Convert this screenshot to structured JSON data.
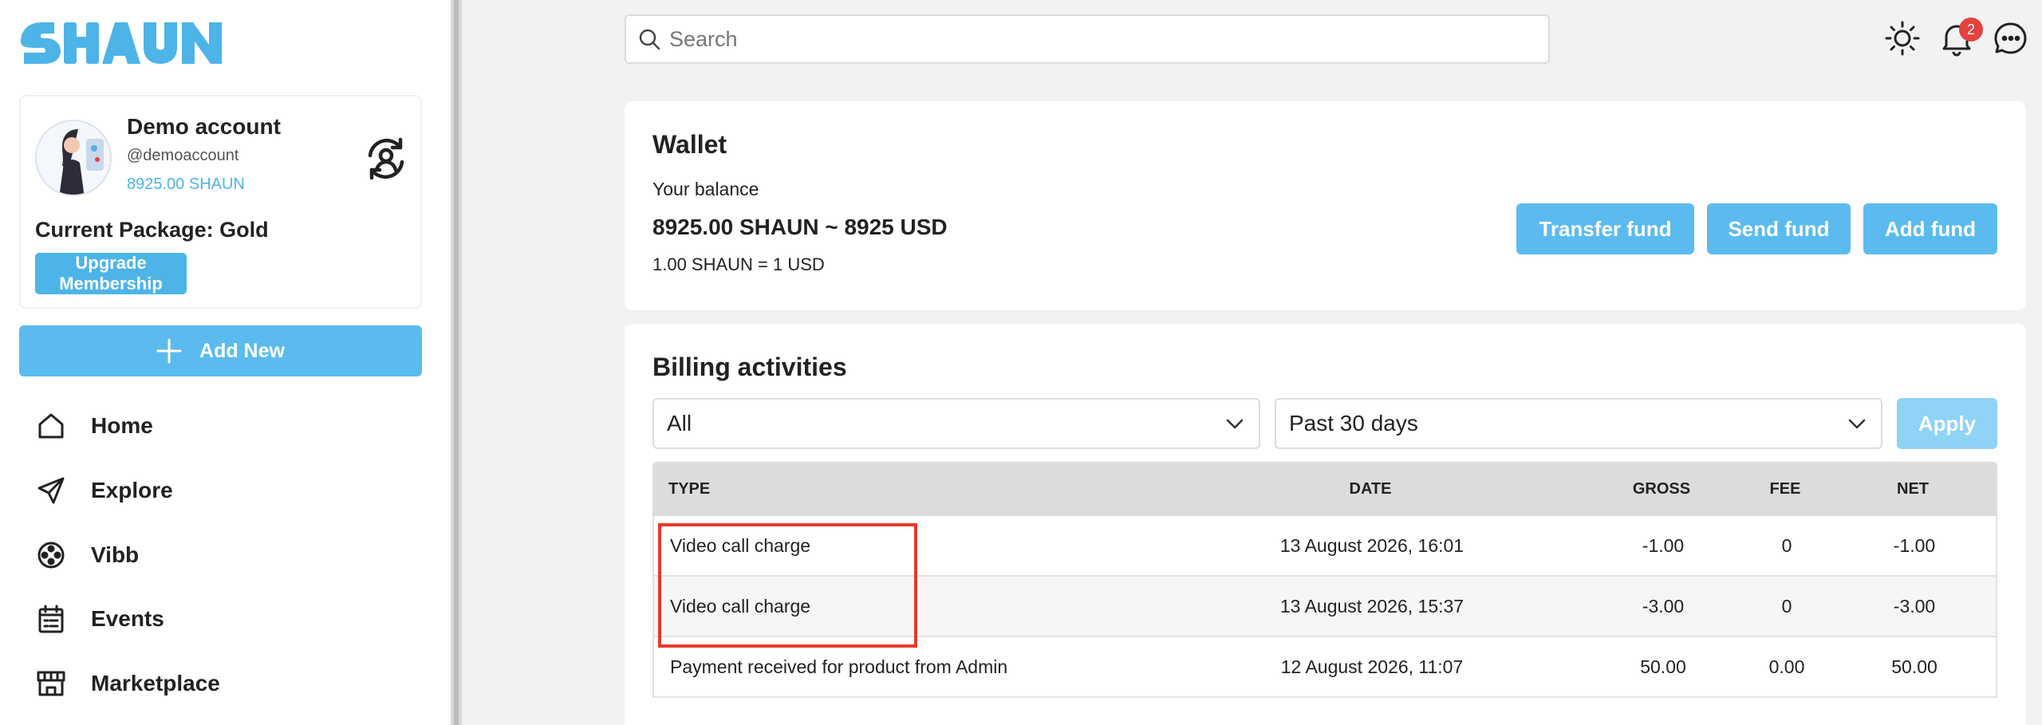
{
  "brand": {
    "logo_text": "SHAUN",
    "logo_color": "#4db4e8",
    "accent": "#5bbbef"
  },
  "profile": {
    "name": "Demo account",
    "handle": "@demoaccount",
    "balance": "8925.00 SHAUN",
    "package": "Current Package: Gold",
    "upgrade_label": "Upgrade Membership"
  },
  "sidebar": {
    "add_new_label": "Add New",
    "items": [
      {
        "label": "Home",
        "icon": "home-icon"
      },
      {
        "label": "Explore",
        "icon": "send-icon"
      },
      {
        "label": "Vibb",
        "icon": "film-reel-icon"
      },
      {
        "label": "Events",
        "icon": "calendar-icon"
      },
      {
        "label": "Marketplace",
        "icon": "store-icon"
      }
    ]
  },
  "header": {
    "search_placeholder": "Search",
    "notification_count": "2"
  },
  "wallet": {
    "title": "Wallet",
    "balance_label": "Your balance",
    "balance": "8925.00 SHAUN ~ 8925 USD",
    "rate": "1.00 SHAUN = 1 USD",
    "buttons": {
      "transfer": "Transfer fund",
      "send": "Send fund",
      "add": "Add fund"
    }
  },
  "billing": {
    "title": "Billing activities",
    "type_filter": "All",
    "period_filter": "Past 30 days",
    "apply_label": "Apply",
    "columns": {
      "type": "TYPE",
      "date": "DATE",
      "gross": "GROSS",
      "fee": "FEE",
      "net": "NET"
    },
    "rows": [
      {
        "type": "Video call charge",
        "date": "13 August 2026, 16:01",
        "gross": "-1.00",
        "fee": "0",
        "net": "-1.00"
      },
      {
        "type": "Video call charge",
        "date": "13 August 2026, 15:37",
        "gross": "-3.00",
        "fee": "0",
        "net": "-3.00"
      },
      {
        "type": "Payment received for product from Admin",
        "date": "12 August 2026, 11:07",
        "gross": "50.00",
        "fee": "0.00",
        "net": "50.00"
      }
    ]
  }
}
